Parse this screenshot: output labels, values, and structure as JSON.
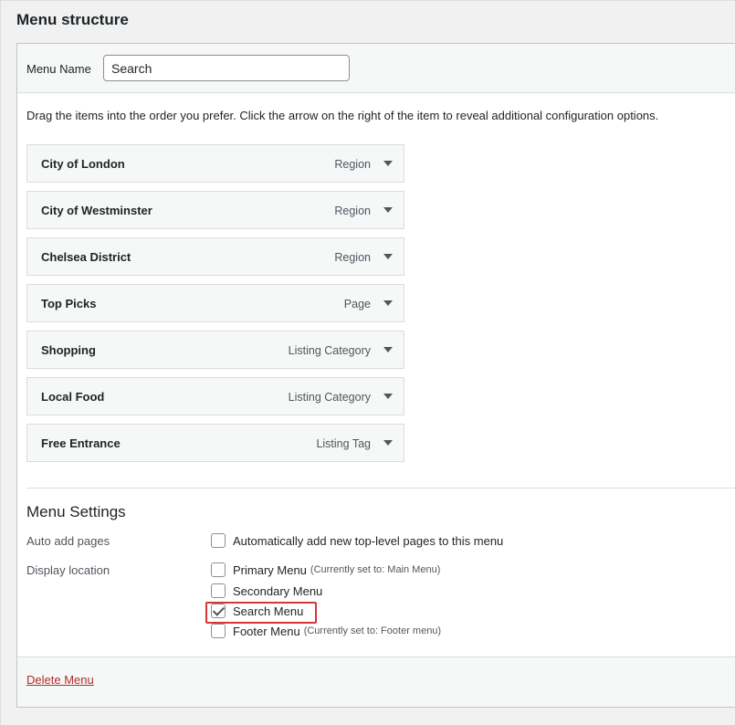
{
  "page": {
    "title": "Menu structure"
  },
  "menu_name": {
    "label": "Menu Name",
    "value": "Search"
  },
  "instructions": "Drag the items into the order you prefer. Click the arrow on the right of the item to reveal additional configuration options.",
  "menu_items": [
    {
      "title": "City of London",
      "type": "Region"
    },
    {
      "title": "City of Westminster",
      "type": "Region"
    },
    {
      "title": "Chelsea District",
      "type": "Region"
    },
    {
      "title": "Top Picks",
      "type": "Page"
    },
    {
      "title": "Shopping",
      "type": "Listing Category"
    },
    {
      "title": "Local Food",
      "type": "Listing Category"
    },
    {
      "title": "Free Entrance",
      "type": "Listing Tag"
    }
  ],
  "settings": {
    "title": "Menu Settings",
    "auto_add": {
      "label": "Auto add pages",
      "option": "Automatically add new top-level pages to this menu",
      "checked": false
    },
    "display_location": {
      "label": "Display location",
      "options": [
        {
          "label": "Primary Menu",
          "note": "(Currently set to: Main Menu)",
          "checked": false
        },
        {
          "label": "Secondary Menu",
          "note": "",
          "checked": false
        },
        {
          "label": "Search Menu",
          "note": "",
          "checked": true
        },
        {
          "label": "Footer Menu",
          "note": "(Currently set to: Footer menu)",
          "checked": false
        }
      ]
    }
  },
  "footer": {
    "delete_label": "Delete Menu"
  },
  "colors": {
    "highlight": "#d63638",
    "delete_link": "#b32d2e"
  }
}
